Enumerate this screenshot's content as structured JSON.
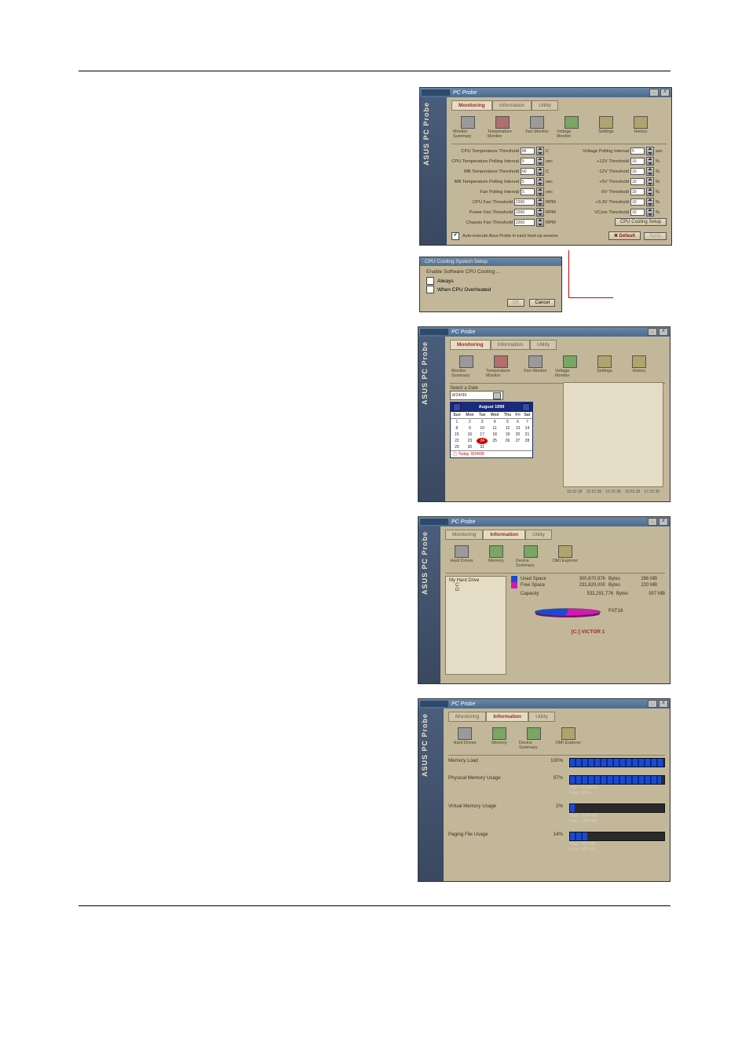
{
  "app": {
    "brand": "ASUS",
    "title": "PC Probe",
    "sidebar_label": "ASUS PC Probe",
    "win_min": "_",
    "win_close": "X"
  },
  "tabs": {
    "monitoring": "Monitoring",
    "information": "Information",
    "utility": "Utility"
  },
  "toolbar_monitor": {
    "monitor_summary": "Monitor Summary",
    "temperature_monitor": "Temperature Monitor",
    "fan_monitor": "Fan Monitor",
    "voltage_monitor": "Voltage Monitor",
    "settings": "Settings",
    "history": "History"
  },
  "settings": {
    "left": {
      "cpu_temp_threshold": {
        "label": "CPU Temperature Threshold",
        "value": "85",
        "unit": "C"
      },
      "cpu_temp_polling": {
        "label": "CPU Temperature Polling Interval",
        "value": "5",
        "unit": "sec"
      },
      "mb_temp_threshold": {
        "label": "MB Temperature Threshold",
        "value": "60",
        "unit": "C"
      },
      "mb_temp_polling": {
        "label": "MB Temperature Polling Interval",
        "value": "5",
        "unit": "sec"
      },
      "fan_polling": {
        "label": "Fan Polling Interval",
        "value": "5",
        "unit": "sec"
      },
      "cpu_fan_threshold": {
        "label": "CPU Fan Threshold",
        "value": "2200",
        "unit": "RPM"
      },
      "power_fan_threshold": {
        "label": "Power Fan Threshold",
        "value": "2200",
        "unit": "RPM"
      },
      "chassis_fan_threshold": {
        "label": "Chassis Fan Threshold",
        "value": "2200",
        "unit": "RPM"
      }
    },
    "right": {
      "voltage_polling": {
        "label": "Voltage Polling Interval",
        "value": "5",
        "unit": "sec"
      },
      "p12v": {
        "label": "+12V Threshold",
        "value": "10",
        "unit": "%"
      },
      "m12v": {
        "label": "-12V Threshold",
        "value": "10",
        "unit": "%"
      },
      "p5v": {
        "label": "+5V Threshold",
        "value": "10",
        "unit": "%"
      },
      "m5v": {
        "label": "-5V Threshold",
        "value": "10",
        "unit": "%"
      },
      "p3_3v": {
        "label": "+3.3V Threshold",
        "value": "10",
        "unit": "%"
      },
      "vcore": {
        "label": "VCore Threshold",
        "value": "10",
        "unit": "%"
      }
    },
    "cpu_cooling_setup_btn": "CPU Cooling Setup",
    "auto_exec_label": "Auto-execute Asus Probe in each boot-up session",
    "default_btn": "Default",
    "apply_btn": "Apply"
  },
  "cooling_popup": {
    "title": "CPU Cooling System Setup",
    "subtitle": "Enable Software CPU Cooling ...",
    "opt_always": "Always",
    "opt_overheated": "When CPU Overheated",
    "ok": "OK",
    "cancel": "Cancel"
  },
  "history": {
    "select_date_label": "Select a Date",
    "selected_date": "8/24/99",
    "month_title": "August 1999",
    "weekdays": [
      "Sun",
      "Mon",
      "Tue",
      "Wed",
      "Thu",
      "Fri",
      "Sat"
    ],
    "weeks": [
      [
        "1",
        "2",
        "3",
        "4",
        "5",
        "6",
        "7"
      ],
      [
        "8",
        "9",
        "10",
        "11",
        "12",
        "13",
        "14"
      ],
      [
        "15",
        "16",
        "17",
        "18",
        "19",
        "20",
        "21"
      ],
      [
        "22",
        "23",
        "24",
        "25",
        "26",
        "27",
        "28"
      ],
      [
        "29",
        "30",
        "31",
        "",
        "",
        "",
        ""
      ]
    ],
    "today_label": "Today: 8/24/99",
    "xticks": [
      "15:22:38",
      "15:52:38",
      "16:22:38",
      "16:52:38",
      "17:22:38"
    ]
  },
  "toolbar_info": {
    "hard_drives": "Hard Drives",
    "memory": "Memory",
    "device_summary": "Device Summary",
    "dmi_explorer": "DMI Explorer"
  },
  "harddrive": {
    "tree_root": "My Hard Drive",
    "tree_c": "C:",
    "tree_d": "D:",
    "used_label": "Used Space",
    "free_label": "Free Space",
    "capacity_label": "Capacity",
    "used_bytes_label": "300,670,976",
    "free_bytes_label": "231,620,000",
    "capacity_bytes_label": "532,291,776",
    "bytes_unit": "Bytes",
    "used_mb": "286 MB",
    "free_mb": "220 MB",
    "capacity_mb": "507 MB",
    "filesystem": "FAT16",
    "volume_name": "[C:] VICTOR 1"
  },
  "memory": {
    "rows": {
      "load": {
        "label": "Memory Load",
        "value": "100%",
        "pct": 100,
        "note_total": "",
        "note_free": ""
      },
      "physical": {
        "label": "Physical Memory Usage",
        "value": "97%",
        "pct": 97,
        "note_total": "Total : 31,048 K",
        "note_free": "Free : 680 K"
      },
      "virtual": {
        "label": "Virtual Memory Usage",
        "value": "2%",
        "pct": 6,
        "note_total": "Total : 2044 MB",
        "note_free": "Free : 1986 MB"
      },
      "paging": {
        "label": "Paging File Usage",
        "value": "14%",
        "pct": 18,
        "note_total": "Total : 260 MB",
        "note_free": "Free : 222 MB"
      }
    }
  }
}
